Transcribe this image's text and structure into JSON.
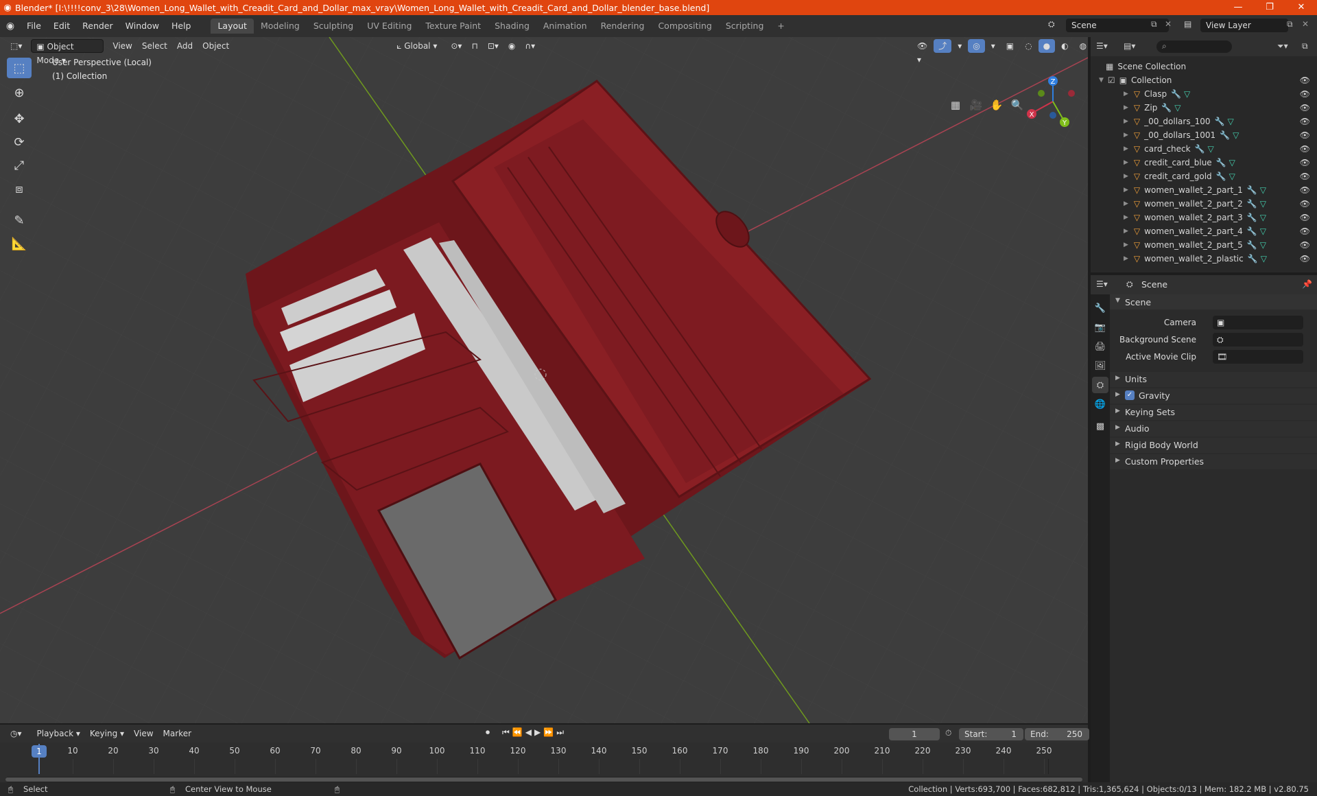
{
  "window": {
    "title": "Blender* [I:\\!!!!conv_3\\28\\Women_Long_Wallet_with_Creadit_Card_and_Dollar_max_vray\\Women_Long_Wallet_with_Creadit_Card_and_Dollar_blender_base.blend]",
    "minimize": "—",
    "maximize": "❐",
    "close": "✕"
  },
  "menubar": {
    "menus": [
      "File",
      "Edit",
      "Render",
      "Window",
      "Help"
    ],
    "workspaces": [
      "Layout",
      "Modeling",
      "Sculpting",
      "UV Editing",
      "Texture Paint",
      "Shading",
      "Animation",
      "Rendering",
      "Compositing",
      "Scripting"
    ],
    "active_workspace": "Layout",
    "add_tab": "+",
    "scene": "Scene",
    "view_layer": "View Layer"
  },
  "viewport": {
    "mode": "Object Mode",
    "menus": [
      "View",
      "Select",
      "Add",
      "Object"
    ],
    "orientation": "Global",
    "perspective_label": "User Perspective (Local)",
    "collection_label": "(1) Collection",
    "gizmo": {
      "x": "X",
      "y": "Y",
      "z": "Z"
    }
  },
  "outliner": {
    "search_placeholder": "",
    "root": "Scene Collection",
    "collection": "Collection",
    "objects": [
      "Clasp",
      "Zip",
      "_00_dollars_100",
      "_00_dollars_1001",
      "card_check",
      "credit_card_blue",
      "credit_card_gold",
      "women_wallet_2_part_1",
      "women_wallet_2_part_2",
      "women_wallet_2_part_3",
      "women_wallet_2_part_4",
      "women_wallet_2_part_5",
      "women_wallet_2_plastic"
    ]
  },
  "properties": {
    "context": "Scene",
    "panel_title": "Scene",
    "fields": {
      "camera_label": "Camera",
      "background_label": "Background Scene",
      "movieclip_label": "Active Movie Clip"
    },
    "sections": [
      "Units",
      "Gravity",
      "Keying Sets",
      "Audio",
      "Rigid Body World",
      "Custom Properties"
    ],
    "gravity_checked": true
  },
  "timeline": {
    "menus": [
      "Playback",
      "Keying",
      "View",
      "Marker"
    ],
    "current_frame": "1",
    "start_label": "Start:",
    "start": "1",
    "end_label": "End:",
    "end": "250",
    "ticks": [
      "10",
      "20",
      "30",
      "40",
      "50",
      "60",
      "70",
      "80",
      "90",
      "100",
      "110",
      "120",
      "130",
      "140",
      "150",
      "160",
      "170",
      "180",
      "190",
      "200",
      "210",
      "220",
      "230",
      "240",
      "250"
    ],
    "playhead": "1"
  },
  "statusbar": {
    "left": "Select",
    "middle": "Center View to Mouse",
    "right": "Collection | Verts:693,700 | Faces:682,812 | Tris:1,365,624 | Objects:0/13 | Mem: 182.2 MB | v2.80.75"
  },
  "colors": {
    "accent": "#5680c2",
    "titlebar": "#e0450f",
    "wallet": "#8a1f24"
  }
}
